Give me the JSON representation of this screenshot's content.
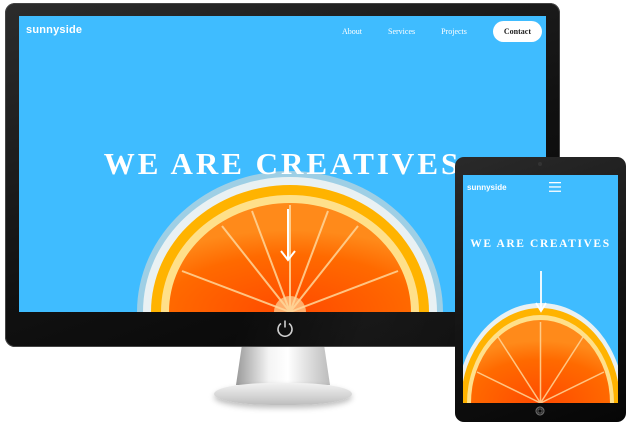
{
  "site": {
    "logo": "sunnyside",
    "nav": {
      "about": "About",
      "services": "Services",
      "projects": "Projects",
      "contact": "Contact"
    },
    "hero_title": "WE ARE CREATIVES"
  },
  "mobile": {
    "logo": "sunnyside",
    "hero_title": "WE ARE CREATIVES",
    "menu_icon": "hamburger-menu-icon"
  },
  "devices": [
    "desktop-monitor",
    "tablet"
  ],
  "colors": {
    "sky": "#3fbcff",
    "orange": "#ff6a00",
    "peel": "#ffb300",
    "text": "#ffffff",
    "contact_text": "#1c1c1c"
  },
  "icons": {
    "arrow": "arrow-down-icon",
    "power": "power-icon",
    "home": "home-button-icon"
  }
}
